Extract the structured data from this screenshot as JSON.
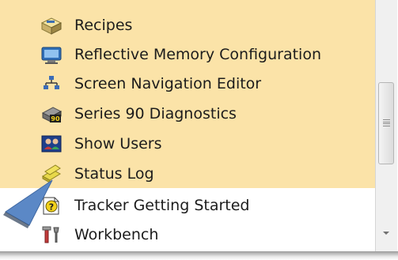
{
  "list": {
    "items": [
      {
        "label": "Recipes",
        "icon": "recipes-icon"
      },
      {
        "label": "Reflective Memory Configuration",
        "icon": "reflective-memory-icon"
      },
      {
        "label": "Screen Navigation Editor",
        "icon": "screen-navigation-icon"
      },
      {
        "label": "Series 90 Diagnostics",
        "icon": "series-90-diagnostics-icon"
      },
      {
        "label": "Show Users",
        "icon": "show-users-icon"
      },
      {
        "label": "Status Log",
        "icon": "status-log-icon"
      },
      {
        "label": "Tracker Getting Started",
        "icon": "tracker-help-icon"
      },
      {
        "label": "Workbench",
        "icon": "workbench-icon"
      }
    ],
    "highlight_color": "#fbe3a8",
    "series90_badge": "90"
  },
  "pointer": {
    "icon": "callout-arrow-icon",
    "color": "#5b88c6"
  }
}
